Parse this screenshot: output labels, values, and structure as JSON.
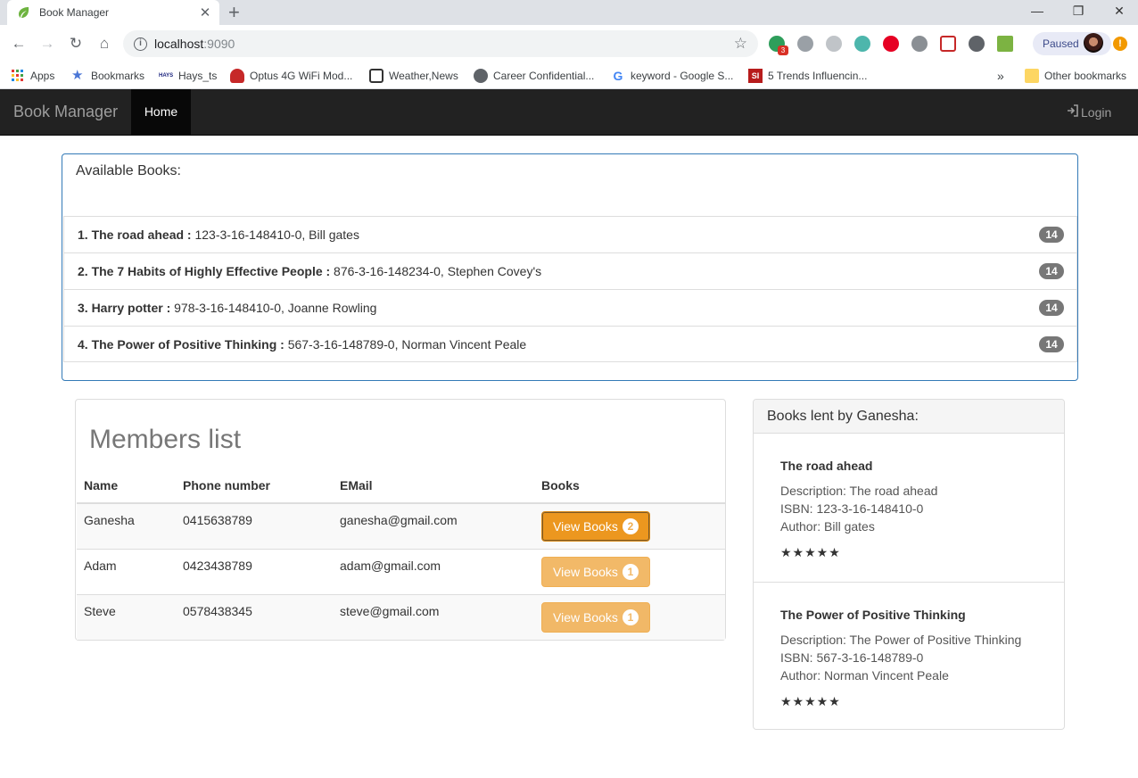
{
  "browser": {
    "tab_title": "Book Manager",
    "url_host": "localhost",
    "url_port": ":9090",
    "paused_label": "Paused",
    "ext_badge": "3",
    "bookmarks": [
      "Apps",
      "Bookmarks",
      "Hays_ts",
      "Optus 4G WiFi Mod...",
      "Weather,News",
      "Career Confidential...",
      "keyword - Google S...",
      "5 Trends Influencin..."
    ],
    "other_bookmarks": "Other bookmarks",
    "overflow": "»"
  },
  "navbar": {
    "brand": "Book Manager",
    "home": "Home",
    "login": "Login"
  },
  "available": {
    "heading": "Available Books:",
    "items": [
      {
        "title": "1. The road ahead :",
        "detail": " 123-3-16-148410-0, Bill gates",
        "count": "14"
      },
      {
        "title": "2. The 7 Habits of Highly Effective People :",
        "detail": " 876-3-16-148234-0, Stephen Covey's",
        "count": "14"
      },
      {
        "title": "3. Harry potter :",
        "detail": " 978-3-16-148410-0, Joanne Rowling",
        "count": "14"
      },
      {
        "title": "4. The Power of Positive Thinking :",
        "detail": " 567-3-16-148789-0, Norman Vincent Peale",
        "count": "14"
      }
    ]
  },
  "members": {
    "heading": "Members list",
    "columns": [
      "Name",
      "Phone number",
      "EMail",
      "Books"
    ],
    "rows": [
      {
        "name": "Ganesha",
        "phone": "0415638789",
        "email": "ganesha@gmail.com",
        "button": "View Books",
        "books": "2"
      },
      {
        "name": "Adam",
        "phone": "0423438789",
        "email": "adam@gmail.com",
        "button": "View Books",
        "books": "1"
      },
      {
        "name": "Steve",
        "phone": "0578438345",
        "email": "steve@gmail.com",
        "button": "View Books",
        "books": "1"
      }
    ]
  },
  "lent": {
    "heading": "Books lent by Ganesha:",
    "books": [
      {
        "title": "The road ahead",
        "description": "Description: The road ahead",
        "isbn": "ISBN: 123-3-16-148410-0",
        "author": "Author: Bill gates",
        "stars": "★★★★★"
      },
      {
        "title": "The Power of Positive Thinking",
        "description": "Description: The Power of Positive Thinking",
        "isbn": "ISBN: 567-3-16-148789-0",
        "author": "Author: Norman Vincent Peale",
        "stars": "★★★★★"
      }
    ]
  },
  "colors": {
    "navbar_bg": "#222222",
    "panel_primary_border": "#337ab7",
    "warning_button": "#f0ad4e",
    "badge": "#777777"
  }
}
